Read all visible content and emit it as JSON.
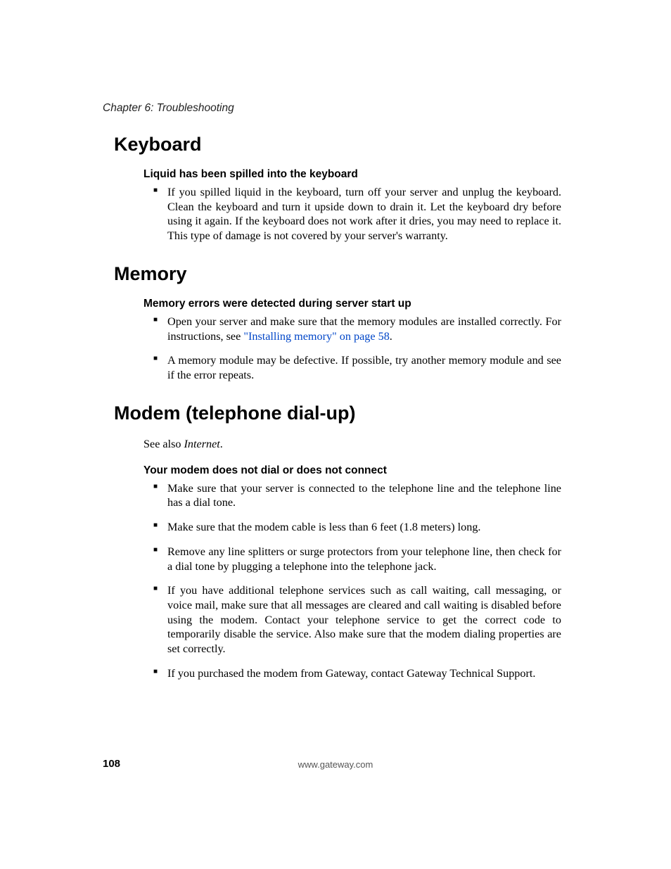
{
  "header": {
    "chapter": "Chapter 6: Troubleshooting"
  },
  "sections": {
    "keyboard": {
      "title": "Keyboard",
      "sub": {
        "title": "Liquid has been spilled into the keyboard",
        "items": [
          "If you spilled liquid in the keyboard, turn off your server and unplug the keyboard. Clean the keyboard and turn it upside down to drain it. Let the keyboard dry before using it again. If the keyboard does not work after it dries, you may need to replace it. This type of damage is not covered by your server's warranty."
        ]
      }
    },
    "memory": {
      "title": "Memory",
      "sub": {
        "title": "Memory errors were detected during server start up",
        "item0_pre": "Open your server and make sure that the memory modules are installed correctly. For instructions, see ",
        "item0_link": "\"Installing memory\" on page 58",
        "item0_post": ".",
        "item1": "A memory module may be defective. If possible, try another memory module and see if the error repeats."
      }
    },
    "modem": {
      "title": "Modem (telephone dial-up)",
      "intro_pre": "See also ",
      "intro_em": "Internet",
      "intro_post": ".",
      "sub": {
        "title": "Your modem does not dial or does not connect",
        "items": [
          "Make sure that your server is connected to the telephone line and the telephone line has a dial tone.",
          "Make sure that the modem cable is less than 6 feet (1.8 meters) long.",
          "Remove any line splitters or surge protectors from your telephone line, then check for a dial tone by plugging a telephone into the telephone jack.",
          "If you have additional telephone services such as call waiting, call messaging, or voice mail, make sure that all messages are cleared and call waiting is disabled before using the modem. Contact your telephone service to get the correct code to temporarily disable the service. Also make sure that the modem dialing properties are set correctly.",
          "If you purchased the modem from Gateway, contact Gateway Technical Support."
        ]
      }
    }
  },
  "footer": {
    "page": "108",
    "url": "www.gateway.com"
  }
}
